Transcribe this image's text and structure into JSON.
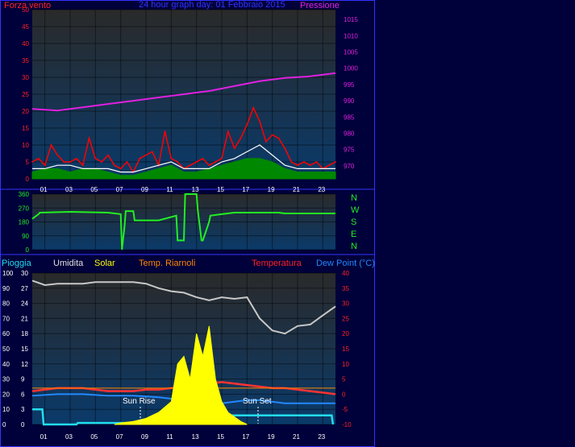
{
  "title": "24 hour graph day: 01 Febbraio 2015",
  "colors": {
    "frame": "#3333ff",
    "bg": "#00003a",
    "plot_top": "#2a2a2a",
    "plot_bottom": "#0a3a6a",
    "wind": "#ff0000",
    "gust": "#008800",
    "avg": "#ffffff",
    "pressure": "#e020e0",
    "winddir": "#22ee22",
    "rain": "#22ddee",
    "humidity": "#c8c8c8",
    "solar": "#ffff00",
    "temp": "#ff3333",
    "indoor": "#ff8800",
    "dew": "#2288ff"
  },
  "x_ticks": [
    "01",
    "03",
    "05",
    "07",
    "09",
    "11",
    "13",
    "15",
    "17",
    "19",
    "21",
    "23"
  ],
  "chart_data": [
    {
      "type": "line",
      "id": "wind-pressure",
      "left_label": "Forza vento",
      "right_label": "Pressione",
      "ylim": [
        0,
        50
      ],
      "y2lim": [
        966,
        1018
      ],
      "yticks": [
        "0",
        "5",
        "10",
        "15",
        "20",
        "25",
        "30",
        "35",
        "40",
        "45",
        "50"
      ],
      "y2ticks": [
        "970",
        "975",
        "980",
        "985",
        "990",
        "995",
        "1000",
        "1005",
        "1010",
        "1015"
      ],
      "series": [
        {
          "key": "wind",
          "x": [
            0,
            0.5,
            1,
            1.5,
            2,
            2.5,
            3,
            3.5,
            4,
            4.5,
            5,
            5.5,
            6,
            6.5,
            7,
            7.5,
            8,
            8.5,
            9,
            9.5,
            10,
            10.5,
            11,
            11.5,
            12,
            12.5,
            13,
            13.5,
            14,
            14.5,
            15,
            15.5,
            16,
            16.5,
            17,
            17.5,
            18,
            18.5,
            19,
            19.5,
            20,
            20.5,
            21,
            21.5,
            22,
            22.5,
            23,
            23.5,
            24
          ],
          "y": [
            5,
            6,
            4,
            10,
            7,
            5,
            5,
            6,
            4,
            12,
            6,
            5,
            7,
            4,
            3,
            5,
            2,
            6,
            7,
            8,
            4,
            14,
            6,
            5,
            3,
            4,
            5,
            6,
            4,
            5,
            6,
            14,
            9,
            12,
            16,
            21,
            17,
            11,
            13,
            12,
            9,
            5,
            4,
            5,
            4,
            5,
            3,
            4,
            5
          ]
        },
        {
          "key": "gust",
          "x": [
            0,
            1,
            2,
            3,
            4,
            5,
            6,
            7,
            8,
            9,
            10,
            11,
            12,
            13,
            14,
            15,
            16,
            17,
            18,
            19,
            20,
            21,
            22,
            23,
            24
          ],
          "y": [
            2,
            3,
            3,
            2,
            3,
            3,
            2,
            1,
            1,
            2,
            3,
            4,
            2,
            2,
            3,
            4,
            5,
            6,
            6,
            5,
            3,
            2,
            2,
            2,
            2
          ]
        },
        {
          "key": "avg",
          "x": [
            0,
            1,
            2,
            3,
            4,
            5,
            6,
            7,
            8,
            9,
            10,
            11,
            12,
            13,
            14,
            15,
            16,
            17,
            18,
            19,
            20,
            21,
            22,
            23,
            24
          ],
          "y": [
            3,
            3,
            4,
            4,
            3,
            3,
            3,
            2,
            2,
            3,
            4,
            5,
            3,
            3,
            3,
            5,
            6,
            8,
            10,
            7,
            4,
            3,
            3,
            3,
            3
          ]
        },
        {
          "key": "pressure",
          "x": [
            0,
            2,
            4,
            6,
            8,
            10,
            12,
            14,
            16,
            18,
            20,
            22,
            24
          ],
          "y": [
            987.5,
            987,
            988,
            989,
            990,
            991,
            992,
            993,
            994.5,
            996,
            997,
            997.5,
            998.5
          ]
        }
      ]
    },
    {
      "type": "line",
      "id": "wind-direction",
      "ylim": [
        0,
        360
      ],
      "yticks": [
        "0",
        "90",
        "180",
        "270",
        "360"
      ],
      "compass": [
        "N",
        "W",
        "S",
        "E",
        "N"
      ],
      "series": [
        {
          "key": "winddir",
          "x": [
            0,
            0.5,
            0.6,
            3,
            6,
            7,
            7.1,
            7.3,
            7.4,
            8,
            8.1,
            10,
            11.4,
            11.5,
            12,
            12.1,
            13,
            13.1,
            13.4,
            13.5,
            14,
            14.1,
            15,
            16,
            18,
            19.5,
            20,
            24
          ],
          "y": [
            200,
            230,
            240,
            245,
            240,
            230,
            0,
            150,
            250,
            250,
            190,
            190,
            220,
            60,
            60,
            360,
            360,
            260,
            60,
            60,
            180,
            220,
            230,
            240,
            240,
            240,
            235,
            235
          ]
        }
      ]
    },
    {
      "type": "line",
      "id": "rain-hum-temp",
      "labels": [
        "Pioggia",
        "Umidita",
        "Solar",
        "Temp. Riarnoli",
        "Temperatura",
        "Dew Point (°C)"
      ],
      "rain_ticks": [
        "0",
        "10",
        "20",
        "30",
        "40",
        "50",
        "60",
        "70",
        "80",
        "90",
        "100"
      ],
      "hum_ticks": [
        "0",
        "3",
        "6",
        "9",
        "12",
        "15",
        "18",
        "21",
        "24",
        "27",
        "30"
      ],
      "temp_ticks": [
        "-10",
        "-5",
        "0",
        "5",
        "10",
        "15",
        "20",
        "25",
        "30",
        "35",
        "40"
      ],
      "ylim": [
        0,
        100
      ],
      "y2lim": [
        -10,
        40
      ],
      "annotations": [
        "Sun Rise",
        "Sun Set"
      ],
      "series": [
        {
          "key": "humidity",
          "x": [
            0,
            1,
            2,
            3,
            4,
            5,
            6,
            7,
            8,
            9,
            10,
            11,
            12,
            13,
            14,
            15,
            16,
            17,
            18,
            19,
            20,
            21,
            22,
            23,
            24
          ],
          "y": [
            95,
            92,
            93,
            93,
            93,
            94,
            94,
            94,
            94,
            93,
            90,
            88,
            87,
            84,
            82,
            84,
            83,
            84,
            70,
            62,
            60,
            65,
            66,
            72,
            78
          ]
        },
        {
          "key": "temp",
          "x": [
            0,
            1,
            2,
            3,
            4,
            5,
            6,
            7,
            8,
            9,
            10,
            11,
            12,
            13,
            14,
            15,
            16,
            17,
            18,
            19,
            20,
            21,
            22,
            23,
            24
          ],
          "y": [
            1,
            1.5,
            2,
            2,
            2,
            1.5,
            1,
            1,
            1,
            1.5,
            1.5,
            2,
            2.5,
            3,
            3.5,
            4,
            3.5,
            3,
            2.5,
            2,
            2,
            1.5,
            1,
            0.5,
            0
          ]
        },
        {
          "key": "indoor",
          "x": [
            0,
            24
          ],
          "y": [
            2,
            2
          ]
        },
        {
          "key": "dew",
          "x": [
            0,
            2,
            4,
            6,
            8,
            10,
            12,
            13,
            14,
            15,
            16,
            17,
            18,
            20,
            22,
            24
          ],
          "y": [
            -0.5,
            0,
            0,
            -0.5,
            -0.5,
            -1,
            -2,
            -3,
            -3,
            -3,
            -2.5,
            -2,
            -2,
            -3,
            -3,
            -3
          ]
        },
        {
          "key": "rain",
          "x": [
            0,
            0.8,
            0.9,
            3.5,
            3.6,
            11,
            12,
            13,
            14,
            15,
            16,
            17,
            18,
            23.7,
            23.8
          ],
          "y": [
            10,
            10,
            0,
            0,
            1,
            1,
            3,
            4.5,
            5.5,
            5.9,
            6,
            6,
            6,
            6,
            0
          ]
        },
        {
          "key": "solar",
          "x": [
            6.5,
            7,
            8,
            9,
            10,
            11,
            11.5,
            12,
            12.5,
            13,
            13.5,
            14,
            14.5,
            15,
            15.5,
            16,
            16.5,
            17
          ],
          "y": [
            0,
            1,
            2,
            4,
            8,
            15,
            40,
            45,
            30,
            60,
            45,
            65,
            30,
            15,
            8,
            5,
            2,
            0
          ]
        }
      ]
    }
  ]
}
